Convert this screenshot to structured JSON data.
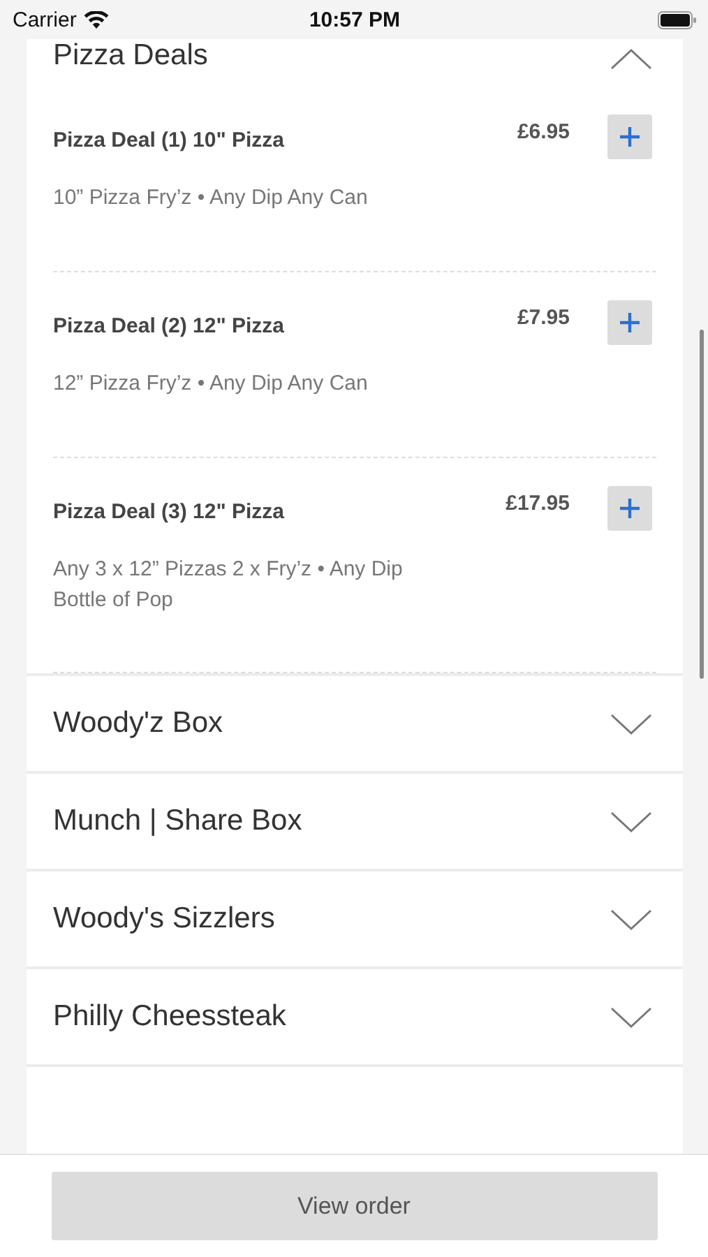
{
  "status_bar": {
    "carrier": "Carrier",
    "time": "10:57 PM"
  },
  "categories": [
    {
      "title": "Pizza Deals",
      "expanded": true,
      "items": [
        {
          "name": "Pizza Deal (1) 10\" Pizza",
          "price": "£6.95",
          "description": "10” Pizza Fry’z • Any Dip Any Can"
        },
        {
          "name": "Pizza Deal (2) 12\" Pizza",
          "price": "£7.95",
          "description": "12” Pizza Fry’z • Any Dip Any Can"
        },
        {
          "name": "Pizza Deal (3) 12\" Pizza",
          "price": "£17.95",
          "description": "Any 3 x 12” Pizzas 2 x Fry’z • Any Dip\nBottle of Pop"
        }
      ]
    },
    {
      "title": "Woody'z Box",
      "expanded": false
    },
    {
      "title": "Munch | Share Box",
      "expanded": false
    },
    {
      "title": "Woody's Sizzlers",
      "expanded": false
    },
    {
      "title": "Philly Cheessteak",
      "expanded": false
    }
  ],
  "footer": {
    "button": "View order"
  }
}
